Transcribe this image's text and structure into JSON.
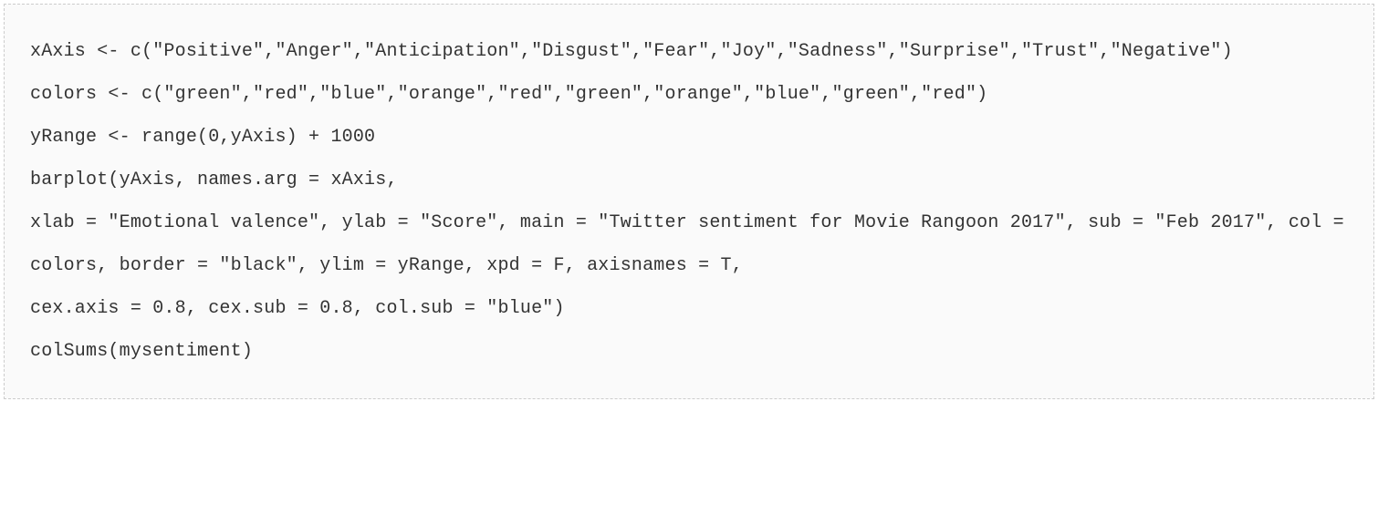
{
  "code": {
    "line1": "xAxis <- c(\"Positive\",\"Anger\",\"Anticipation\",\"Disgust\",\"Fear\",\"Joy\",\"Sadness\",\"Surprise\",\"Trust\",\"Negative\")",
    "line2": "colors <- c(\"green\",\"red\",\"blue\",\"orange\",\"red\",\"green\",\"orange\",\"blue\",\"green\",\"red\")",
    "line3": "yRange <- range(0,yAxis) + 1000",
    "line4": "barplot(yAxis, names.arg = xAxis,",
    "line5": "xlab = \"Emotional valence\", ylab = \"Score\", main = \"Twitter sentiment for Movie Rangoon 2017\", sub = \"Feb 2017\", col = colors, border = \"black\", ylim = yRange, xpd = F, axisnames = T,",
    "line6": "cex.axis = 0.8, cex.sub = 0.8, col.sub = \"blue\")",
    "line7": "colSums(mysentiment)"
  }
}
